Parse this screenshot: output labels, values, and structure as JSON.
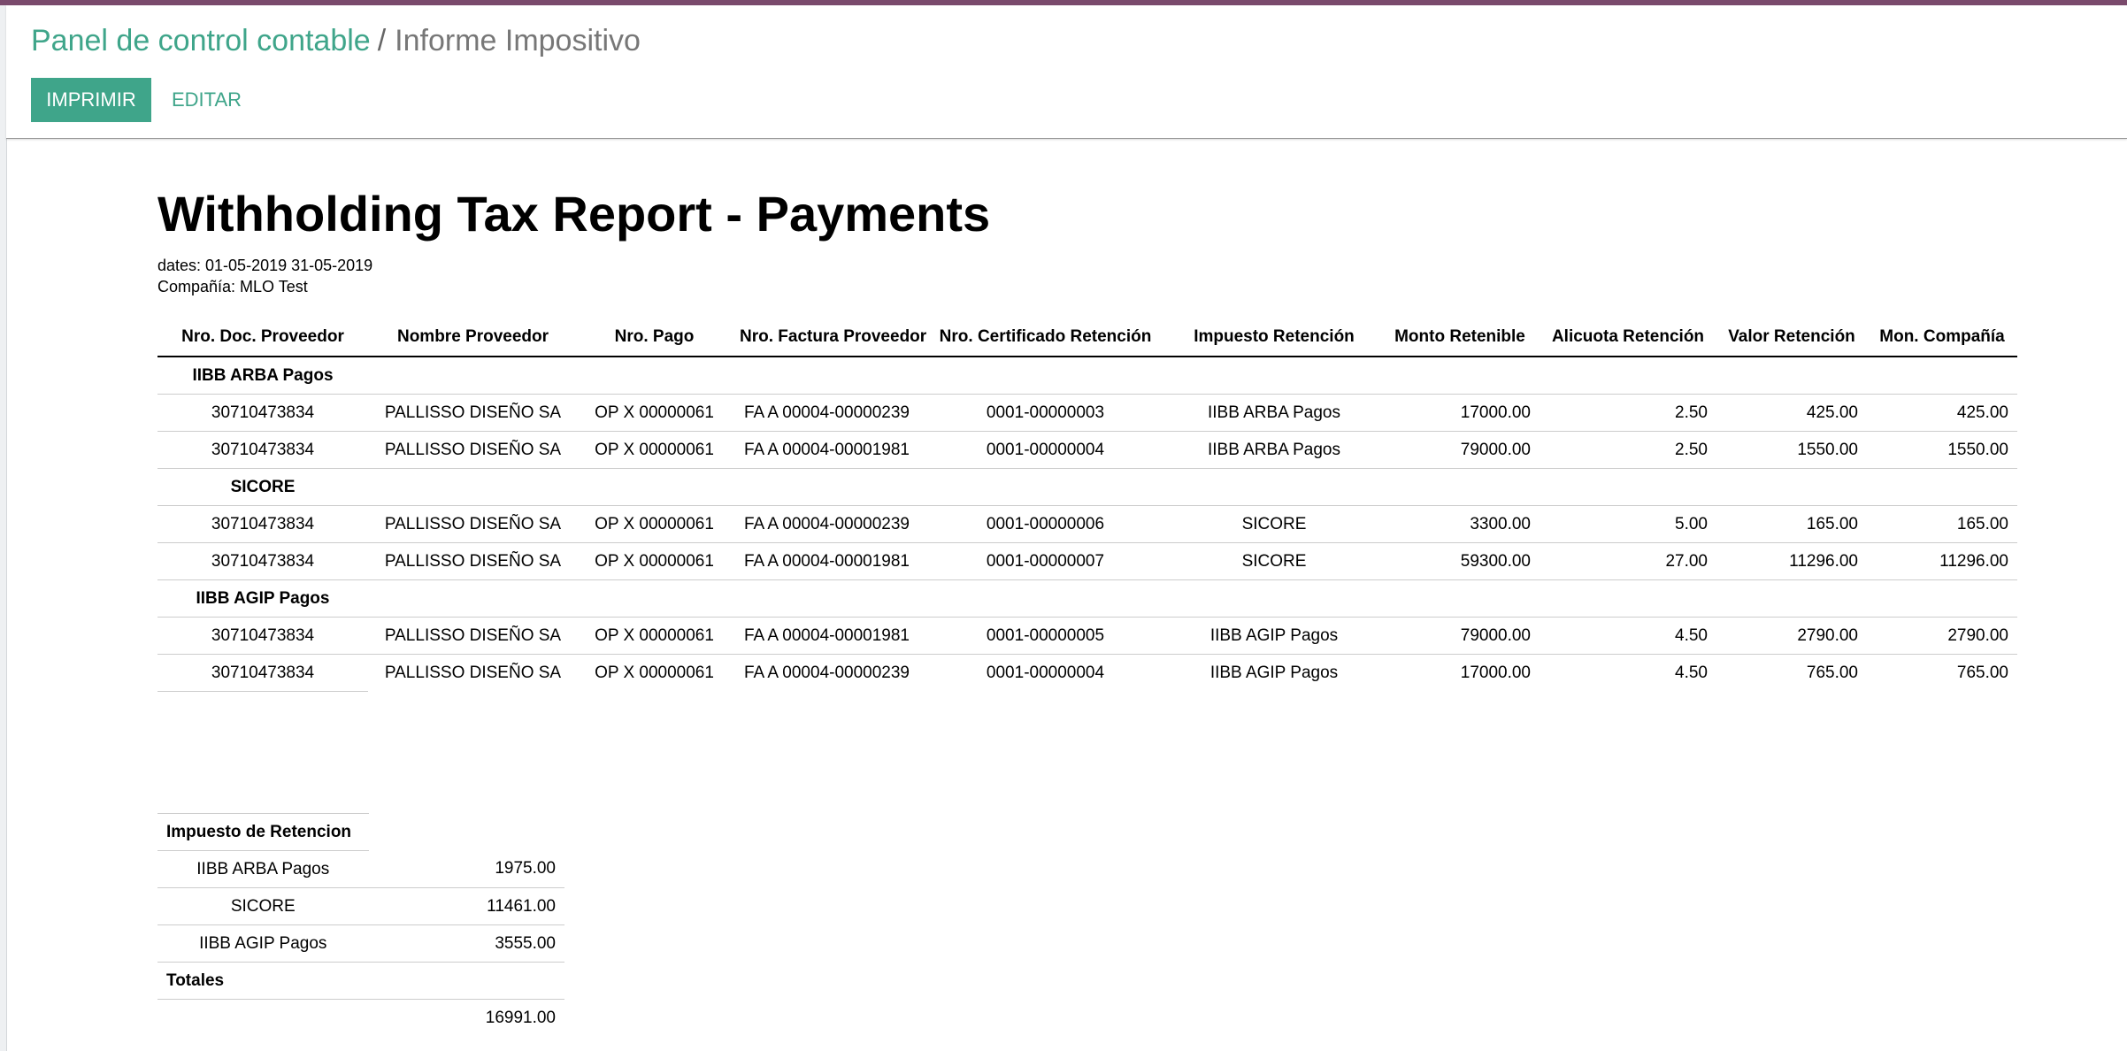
{
  "breadcrumb": {
    "parent": "Panel de control contable",
    "separator": "/",
    "current": "Informe Impositivo"
  },
  "buttons": {
    "print": "IMPRIMIR",
    "edit": "EDITAR"
  },
  "report": {
    "title": "Withholding Tax Report - Payments",
    "dates": "dates: 01-05-2019 31-05-2019",
    "company": "Compañía: MLO Test"
  },
  "table": {
    "headers": [
      "Nro. Doc. Proveedor",
      "Nombre Proveedor",
      "Nro. Pago",
      "Nro. Factura Proveedor",
      "Nro. Certificado Retención",
      "Impuesto Retención",
      "Monto Retenible",
      "Alicuota Retención",
      "Valor Retención",
      "Mon. Compañía"
    ],
    "groups": [
      {
        "name": "IIBB ARBA Pagos",
        "rows": [
          [
            "30710473834",
            "PALLISSO DISEÑO SA",
            "OP X 00000061",
            "FA A 00004-00000239",
            "0001-00000003",
            "IIBB ARBA Pagos",
            "17000.00",
            "2.50",
            "425.00",
            "425.00"
          ],
          [
            "30710473834",
            "PALLISSO DISEÑO SA",
            "OP X 00000061",
            "FA A 00004-00001981",
            "0001-00000004",
            "IIBB ARBA Pagos",
            "79000.00",
            "2.50",
            "1550.00",
            "1550.00"
          ]
        ]
      },
      {
        "name": "SICORE",
        "rows": [
          [
            "30710473834",
            "PALLISSO DISEÑO SA",
            "OP X 00000061",
            "FA A 00004-00000239",
            "0001-00000006",
            "SICORE",
            "3300.00",
            "5.00",
            "165.00",
            "165.00"
          ],
          [
            "30710473834",
            "PALLISSO DISEÑO SA",
            "OP X 00000061",
            "FA A 00004-00001981",
            "0001-00000007",
            "SICORE",
            "59300.00",
            "27.00",
            "11296.00",
            "11296.00"
          ]
        ]
      },
      {
        "name": "IIBB AGIP Pagos",
        "rows": [
          [
            "30710473834",
            "PALLISSO DISEÑO SA",
            "OP X 00000061",
            "FA A 00004-00001981",
            "0001-00000005",
            "IIBB AGIP Pagos",
            "79000.00",
            "4.50",
            "2790.00",
            "2790.00"
          ],
          [
            "30710473834",
            "PALLISSO DISEÑO SA",
            "OP X 00000061",
            "FA A 00004-00000239",
            "0001-00000004",
            "IIBB AGIP Pagos",
            "17000.00",
            "4.50",
            "765.00",
            "765.00"
          ]
        ]
      }
    ]
  },
  "summary": {
    "header": "Impuesto de Retencion",
    "rows": [
      {
        "name": "IIBB ARBA Pagos",
        "value": "1975.00"
      },
      {
        "name": "SICORE",
        "value": "11461.00"
      },
      {
        "name": "IIBB AGIP Pagos",
        "value": "3555.00"
      }
    ],
    "total_label": "Totales",
    "total_value": "16991.00"
  },
  "colors": {
    "accent": "#3fa58a",
    "topbar": "#7a4a6c"
  }
}
